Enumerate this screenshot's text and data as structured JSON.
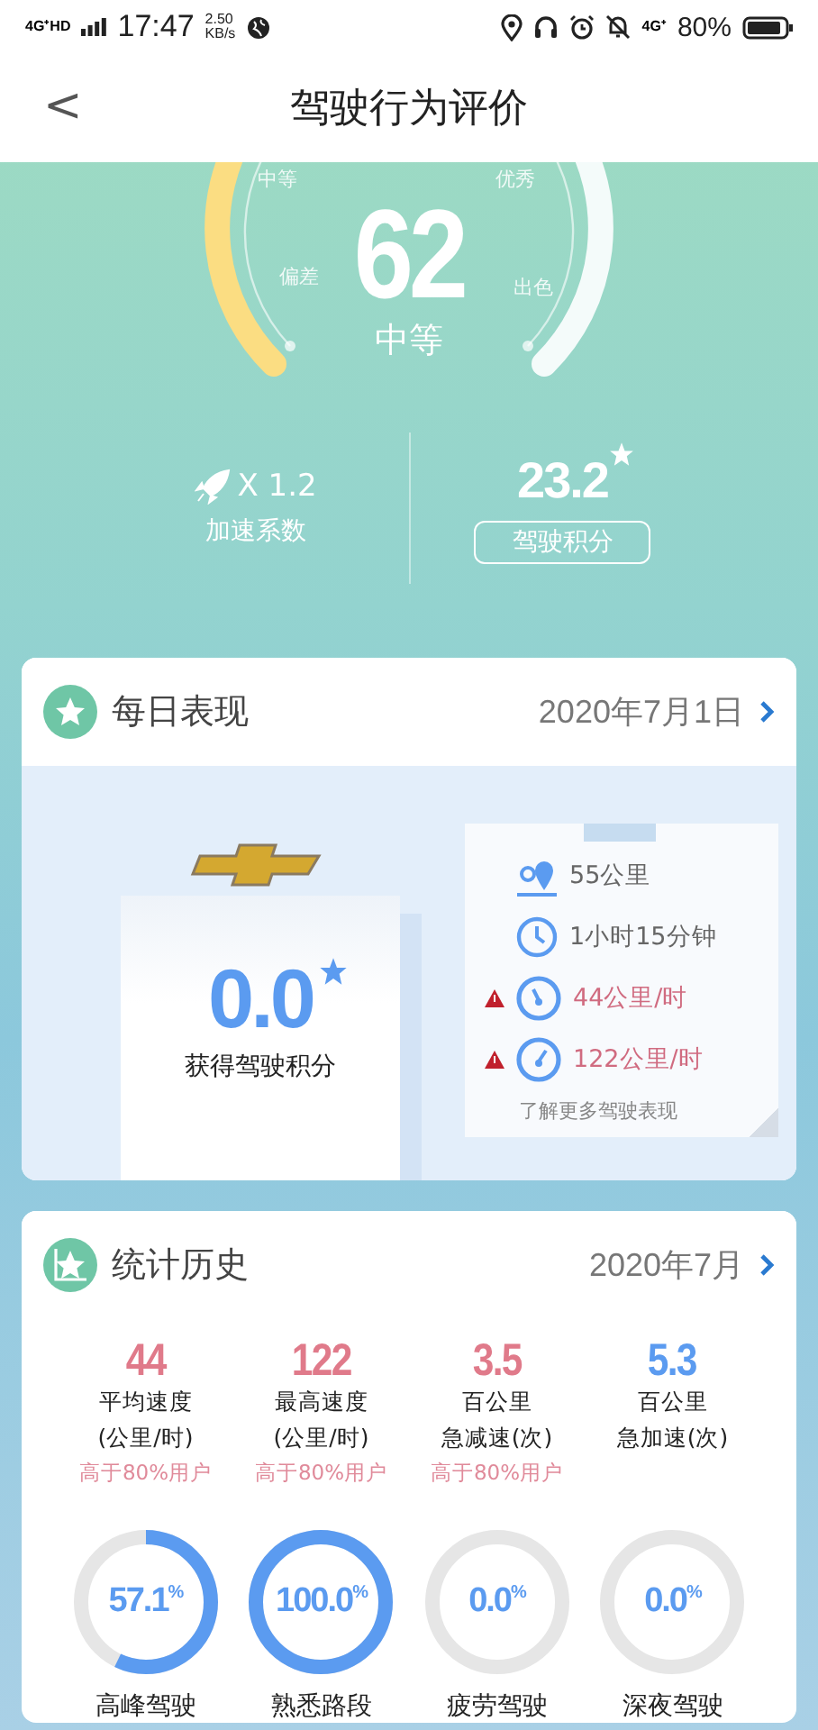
{
  "status_bar": {
    "network": "4G⁺HD",
    "time": "17:47",
    "speed": "2.50",
    "speed_unit": "KB/s",
    "network_right": "4G⁺",
    "battery": "80%"
  },
  "header": {
    "back": "<",
    "title": "驾驶行为评价"
  },
  "score": {
    "value": "62",
    "grade": "中等",
    "gauge_labels": [
      "中等",
      "优秀",
      "偏差",
      "出色"
    ],
    "boost": {
      "value": "X 1.2",
      "label": "加速系数"
    },
    "points": {
      "value": "23.2",
      "label": "驾驶积分"
    }
  },
  "daily": {
    "title": "每日表现",
    "date": "2020年7月1日",
    "points": "0.0",
    "points_label": "获得驾驶积分",
    "stats": [
      {
        "kind": "distance",
        "text": "55公里",
        "warning": false
      },
      {
        "kind": "duration",
        "text": "1小时15分钟",
        "warning": false
      },
      {
        "kind": "average_speed",
        "text": "44公里/时",
        "warning": true
      },
      {
        "kind": "top_speed",
        "text": "122公里/时",
        "warning": true
      }
    ],
    "link": "了解更多驾驶表现"
  },
  "history": {
    "title": "统计历史",
    "month": "2020年7月",
    "metrics": [
      {
        "value": "44",
        "lines": [
          "平均速度",
          "(公里/时)"
        ],
        "note": "高于80%用户",
        "color": "#e07a8a"
      },
      {
        "value": "122",
        "lines": [
          "最高速度",
          "(公里/时)"
        ],
        "note": "高于80%用户",
        "color": "#e07a8a"
      },
      {
        "value": "3.5",
        "lines": [
          "百公里",
          "急减速(次)"
        ],
        "note": "高于80%用户",
        "color": "#e07a8a"
      },
      {
        "value": "5.3",
        "lines": [
          "百公里",
          "急加速(次)"
        ],
        "color": "#5b9bf0"
      }
    ],
    "rings": [
      {
        "value": "57.1",
        "unit": "%",
        "label": "高峰驾驶",
        "level": 0.571
      },
      {
        "value": "100.0",
        "unit": "%",
        "label": "熟悉路段",
        "level": 1.0
      },
      {
        "value": "0.0",
        "unit": "%",
        "label": "疲劳驾驶",
        "level": 0
      },
      {
        "value": "0.0",
        "unit": "%",
        "label": "深夜驾驶",
        "level": 0
      }
    ]
  }
}
